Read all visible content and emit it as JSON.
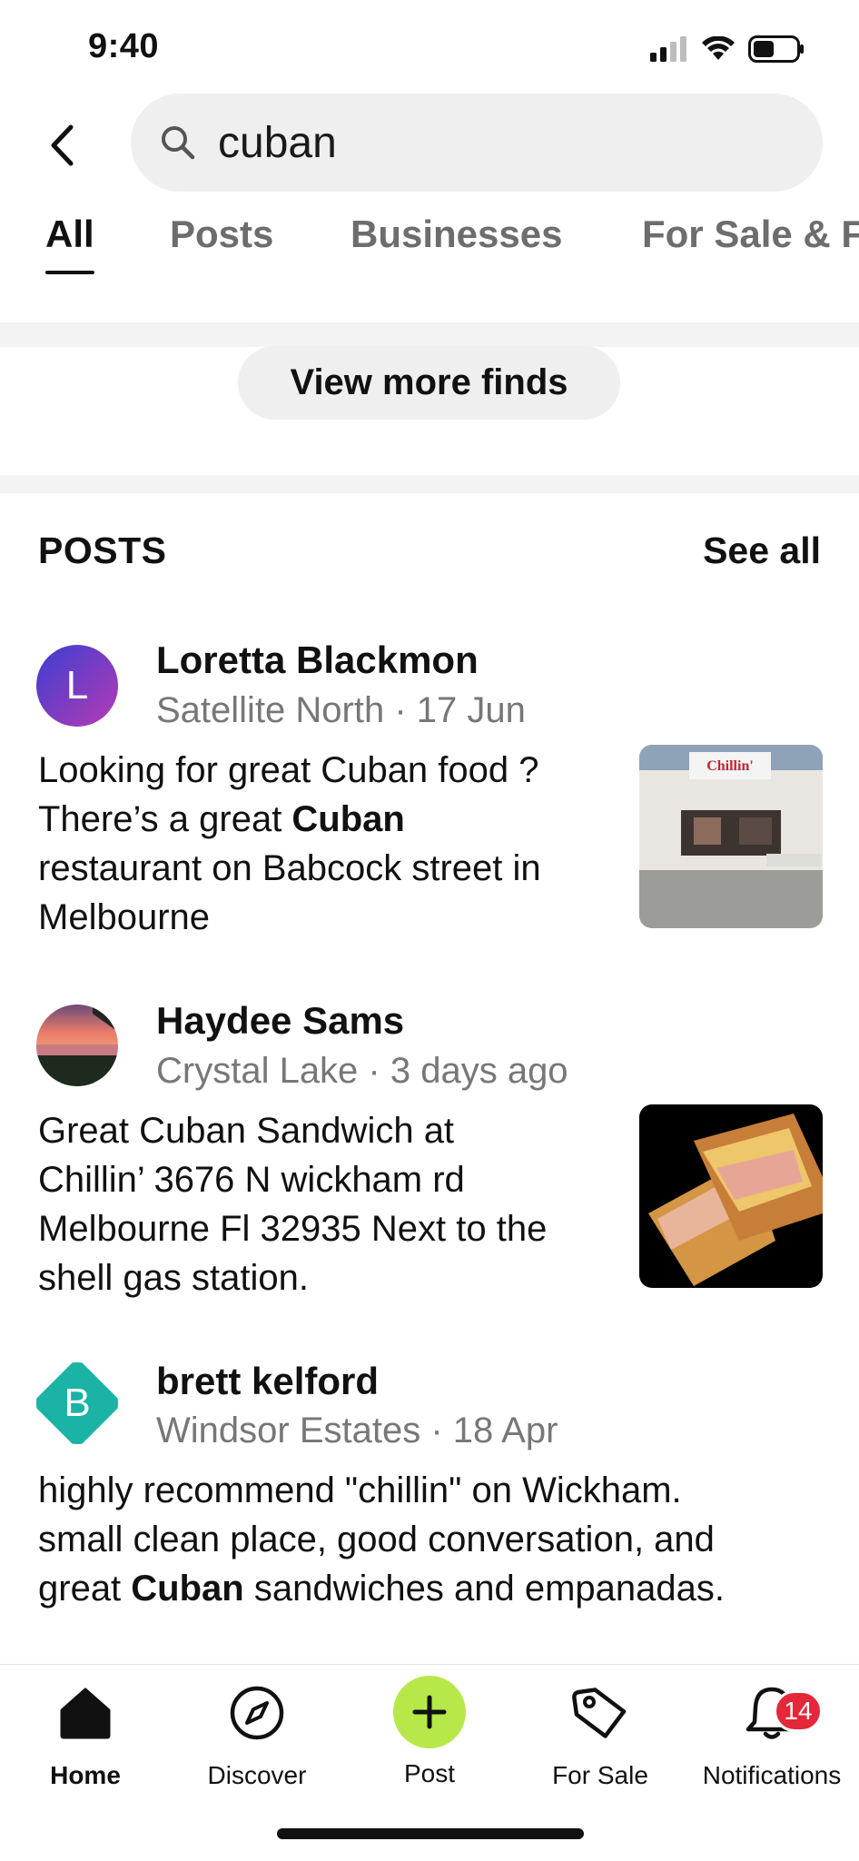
{
  "status_bar": {
    "time": "9:40"
  },
  "search": {
    "query": "cuban"
  },
  "tabs": [
    {
      "label": "All",
      "active": true
    },
    {
      "label": "Posts",
      "active": false
    },
    {
      "label": "Businesses",
      "active": false
    },
    {
      "label": "For Sale & F",
      "active": false
    }
  ],
  "view_more_label": "View more finds",
  "posts_section": {
    "title": "POSTS",
    "see_all": "See all",
    "items": [
      {
        "author": "Loretta Blackmon",
        "avatar_letter": "L",
        "meta": "Satellite North · 17 Jun",
        "text_lines": [
          "Looking for great Cuban  food ?",
          "There’s a great ",
          "Cuban",
          "restaurant on Babcock street in",
          "Melbourne"
        ],
        "thumbnail_sign": "Chillin'"
      },
      {
        "author": "Haydee Sams",
        "meta": "Crystal Lake · 3 days ago",
        "text_lines": [
          "Great Cuban Sandwich at",
          "Chillin’ 3676 N wickham rd",
          "Melbourne Fl 32935 Next to the",
          "shell gas station."
        ]
      },
      {
        "author": "brett kelford",
        "avatar_letter": "B",
        "meta": "Windsor Estates · 18 Apr",
        "text_lines": [
          "highly recommend \"chillin\" on Wickham.",
          "small clean place, good conversation, and",
          "great ",
          "Cuban",
          " sandwiches and empanadas."
        ]
      }
    ]
  },
  "bottom_nav": {
    "items": [
      {
        "label": "Home",
        "icon": "home-icon",
        "active": true
      },
      {
        "label": "Discover",
        "icon": "compass-icon"
      },
      {
        "label": "Post",
        "icon": "plus-icon"
      },
      {
        "label": "For Sale",
        "icon": "price-tag-icon"
      },
      {
        "label": "Notifications",
        "icon": "bell-icon",
        "badge": "14"
      }
    ]
  },
  "colors": {
    "accent_green": "#b7e84a",
    "badge_red": "#e3283a",
    "avatar_l_gradient": [
      "#3a3fd0",
      "#b73ab5"
    ],
    "avatar_b_teal": "#1ab3a6"
  }
}
